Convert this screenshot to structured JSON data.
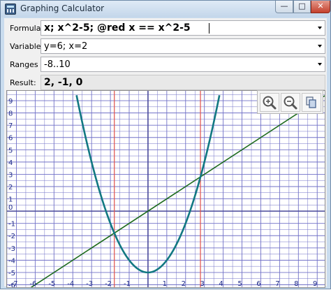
{
  "window": {
    "title": "Graphing Calculator",
    "controls": {
      "minimize": "—",
      "maximize": "□",
      "close": "✕"
    }
  },
  "form": {
    "formula": {
      "label": "Formula",
      "value": "x; x^2-5;  @red x == x^2-5"
    },
    "variables": {
      "label": "Variables",
      "value": "y=6; x=2"
    },
    "ranges": {
      "label": "Ranges",
      "value": "-8..10"
    },
    "result": {
      "label": "Result:",
      "value": "2, -1, 0"
    }
  },
  "toolbar": {
    "zoom_in_icon": "magnifier-plus-icon",
    "zoom_out_icon": "magnifier-minus-icon",
    "copy_icon": "copy-icon"
  },
  "chart_data": {
    "type": "line",
    "xlim": [
      -7.5,
      9.4
    ],
    "ylim": [
      -6.2,
      9.8
    ],
    "grid": true,
    "x_ticks": [
      -7,
      -6,
      -5,
      -4,
      -3,
      -2,
      -1,
      0,
      1,
      2,
      3,
      4,
      5,
      6,
      7,
      8,
      9
    ],
    "y_ticks": [
      -6,
      -5,
      -4,
      -3,
      -2,
      -1,
      0,
      1,
      2,
      3,
      4,
      5,
      6,
      7,
      8,
      9
    ],
    "series": [
      {
        "expression": "x",
        "color": "#1e6b1e",
        "points": [
          [
            -7.5,
            -7.5
          ],
          [
            9.4,
            9.4
          ]
        ]
      },
      {
        "expression": "x^2-5",
        "color": "#127882",
        "points": [
          [
            -3.8,
            9.44
          ],
          [
            -3,
            4
          ],
          [
            -2,
            -1
          ],
          [
            -1,
            -4
          ],
          [
            0,
            -5
          ],
          [
            1,
            -4
          ],
          [
            2,
            -1
          ],
          [
            3,
            4
          ],
          [
            3.8,
            9.44
          ]
        ]
      }
    ],
    "vertical_markers": {
      "color": "#e0504a",
      "x": [
        -1.79,
        2.79
      ]
    },
    "colors": {
      "grid": "#7171c7",
      "axis": "#4a4a9a",
      "tick_label": "#1f2b8a"
    }
  }
}
